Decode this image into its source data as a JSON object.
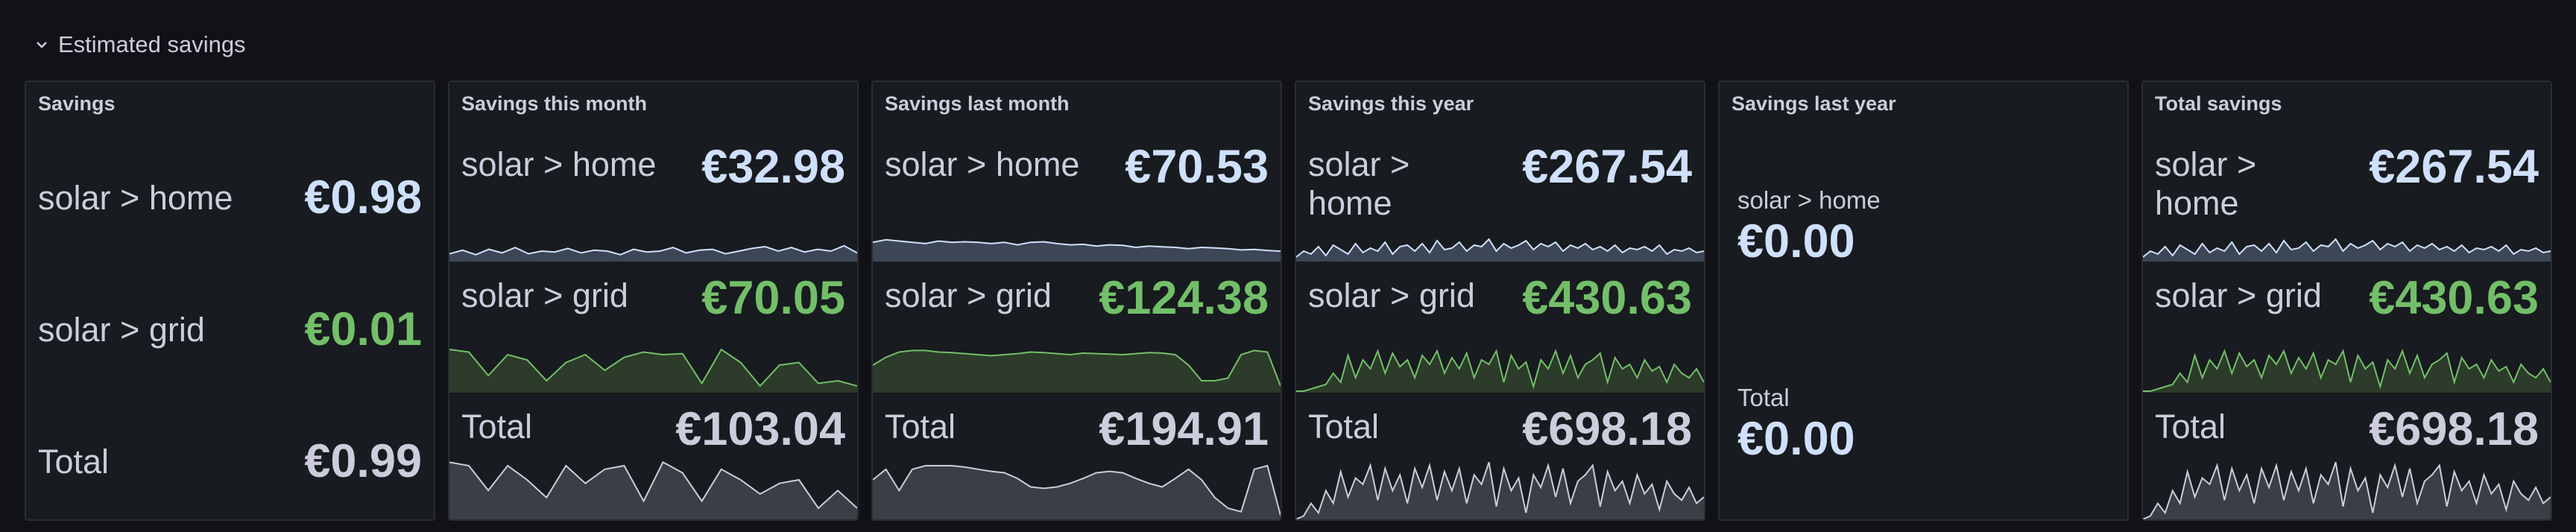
{
  "row": {
    "title": "Estimated savings"
  },
  "colors": {
    "blue": "#cfe0fc",
    "green": "#73bf69",
    "text": "#ccccdc",
    "blue_fill": "#3d4656",
    "green_fill": "#2d3b2a",
    "total_fill": "#3c3e45"
  },
  "savings": {
    "title": "Savings",
    "rows": [
      {
        "label": "solar > home",
        "value": "€0.98"
      },
      {
        "label": "solar > grid",
        "value": "€0.01"
      },
      {
        "label": "Total",
        "value": "€0.99"
      }
    ]
  },
  "this_month": {
    "title": "Savings this month",
    "rows": [
      {
        "label": "solar > home",
        "value": "€32.98",
        "series": [
          0.35,
          0.55,
          0.3,
          0.6,
          0.4,
          0.7,
          0.35,
          0.5,
          0.45,
          0.65,
          0.4,
          0.55,
          0.5,
          0.3,
          0.6,
          0.45,
          0.5,
          0.7,
          0.4,
          0.55,
          0.6,
          0.35,
          0.5,
          0.65,
          0.75,
          0.5,
          0.7,
          0.45,
          0.6,
          0.5,
          0.8,
          0.4
        ]
      },
      {
        "label": "solar > grid",
        "value": "€70.05",
        "series": [
          0.8,
          0.75,
          0.3,
          0.7,
          0.6,
          0.2,
          0.55,
          0.7,
          0.4,
          0.65,
          0.75,
          0.7,
          0.72,
          0.15,
          0.8,
          0.55,
          0.1,
          0.5,
          0.55,
          0.15,
          0.2,
          0.1
        ]
      },
      {
        "label": "Total",
        "value": "€103.04",
        "series": [
          0.85,
          0.8,
          0.45,
          0.8,
          0.6,
          0.35,
          0.8,
          0.55,
          0.75,
          0.8,
          0.3,
          0.85,
          0.7,
          0.3,
          0.75,
          0.6,
          0.4,
          0.55,
          0.6,
          0.2,
          0.45,
          0.2
        ]
      }
    ]
  },
  "last_month": {
    "title": "Savings last month",
    "rows": [
      {
        "label": "solar > home",
        "value": "€70.53",
        "series": [
          0.7,
          0.8,
          0.75,
          0.7,
          0.65,
          0.75,
          0.7,
          0.72,
          0.7,
          0.65,
          0.7,
          0.6,
          0.7,
          0.72,
          0.65,
          0.6,
          0.62,
          0.55,
          0.6,
          0.58,
          0.5,
          0.55,
          0.52,
          0.5,
          0.45,
          0.5,
          0.48,
          0.45,
          0.4,
          0.42,
          0.38,
          0.35
        ]
      },
      {
        "label": "solar > grid",
        "value": "€124.38",
        "series": [
          0.5,
          0.65,
          0.75,
          0.78,
          0.78,
          0.75,
          0.74,
          0.72,
          0.7,
          0.68,
          0.7,
          0.72,
          0.75,
          0.74,
          0.72,
          0.7,
          0.73,
          0.72,
          0.71,
          0.7,
          0.72,
          0.74,
          0.73,
          0.7,
          0.5,
          0.2,
          0.2,
          0.25,
          0.7,
          0.78,
          0.75,
          0.1
        ]
      },
      {
        "label": "Total",
        "value": "€194.91",
        "series": [
          0.6,
          0.75,
          0.45,
          0.75,
          0.8,
          0.8,
          0.8,
          0.78,
          0.75,
          0.72,
          0.7,
          0.62,
          0.5,
          0.48,
          0.5,
          0.55,
          0.62,
          0.7,
          0.72,
          0.7,
          0.62,
          0.55,
          0.5,
          0.62,
          0.75,
          0.6,
          0.35,
          0.2,
          0.15,
          0.75,
          0.8,
          0.1
        ]
      }
    ]
  },
  "this_year": {
    "title": "Savings this year",
    "rows": [
      {
        "label": "solar > home",
        "value": "€267.54",
        "series": [
          0.1,
          0.3,
          0.2,
          0.45,
          0.15,
          0.5,
          0.35,
          0.2,
          0.55,
          0.25,
          0.4,
          0.3,
          0.6,
          0.2,
          0.45,
          0.5,
          0.3,
          0.55,
          0.25,
          0.65,
          0.35,
          0.4,
          0.6,
          0.3,
          0.5,
          0.45,
          0.7,
          0.3,
          0.55,
          0.4,
          0.5,
          0.65,
          0.35,
          0.55,
          0.45,
          0.6,
          0.3,
          0.5,
          0.4,
          0.55,
          0.35,
          0.45,
          0.3,
          0.5,
          0.25,
          0.4,
          0.35,
          0.45,
          0.3,
          0.5,
          0.2,
          0.35,
          0.3,
          0.4,
          0.25,
          0.3
        ]
      },
      {
        "label": "solar > grid",
        "value": "€430.63",
        "series": [
          0.0,
          0.0,
          0.05,
          0.1,
          0.15,
          0.4,
          0.2,
          0.8,
          0.3,
          0.7,
          0.5,
          0.9,
          0.4,
          0.85,
          0.55,
          0.7,
          0.3,
          0.8,
          0.6,
          0.9,
          0.4,
          0.75,
          0.5,
          0.85,
          0.3,
          0.7,
          0.6,
          0.9,
          0.2,
          0.8,
          0.5,
          0.65,
          0.1,
          0.7,
          0.5,
          0.9,
          0.4,
          0.8,
          0.3,
          0.6,
          0.7,
          0.85,
          0.2,
          0.75,
          0.5,
          0.6,
          0.3,
          0.7,
          0.45,
          0.55,
          0.2,
          0.6,
          0.4,
          0.3,
          0.5,
          0.2
        ]
      },
      {
        "label": "Total",
        "value": "€698.18",
        "series": [
          0.05,
          0.1,
          0.3,
          0.15,
          0.5,
          0.3,
          0.8,
          0.4,
          0.7,
          0.6,
          0.9,
          0.35,
          0.85,
          0.5,
          0.75,
          0.3,
          0.85,
          0.55,
          0.9,
          0.35,
          0.8,
          0.5,
          0.85,
          0.3,
          0.75,
          0.6,
          0.95,
          0.25,
          0.85,
          0.5,
          0.7,
          0.15,
          0.75,
          0.55,
          0.9,
          0.4,
          0.85,
          0.3,
          0.65,
          0.75,
          0.9,
          0.25,
          0.8,
          0.5,
          0.65,
          0.3,
          0.75,
          0.45,
          0.6,
          0.2,
          0.65,
          0.45,
          0.35,
          0.55,
          0.3,
          0.4
        ]
      }
    ]
  },
  "last_year": {
    "title": "Savings last year",
    "rows": [
      {
        "label": "solar > home",
        "value": "€0.00"
      },
      {
        "label": "Total",
        "value": "€0.00"
      }
    ]
  },
  "total": {
    "title": "Total savings",
    "rows": [
      {
        "label": "solar > home",
        "value": "€267.54",
        "series": [
          0.1,
          0.3,
          0.2,
          0.45,
          0.15,
          0.5,
          0.35,
          0.2,
          0.55,
          0.25,
          0.4,
          0.3,
          0.6,
          0.2,
          0.45,
          0.5,
          0.3,
          0.55,
          0.25,
          0.65,
          0.35,
          0.4,
          0.6,
          0.3,
          0.5,
          0.45,
          0.7,
          0.3,
          0.55,
          0.4,
          0.5,
          0.65,
          0.35,
          0.55,
          0.45,
          0.6,
          0.3,
          0.5,
          0.4,
          0.55,
          0.35,
          0.45,
          0.3,
          0.5,
          0.25,
          0.4,
          0.35,
          0.45,
          0.3,
          0.5,
          0.2,
          0.35,
          0.3,
          0.4,
          0.25,
          0.3
        ]
      },
      {
        "label": "solar > grid",
        "value": "€430.63",
        "series": [
          0.0,
          0.0,
          0.05,
          0.1,
          0.15,
          0.4,
          0.2,
          0.8,
          0.3,
          0.7,
          0.5,
          0.9,
          0.4,
          0.85,
          0.55,
          0.7,
          0.3,
          0.8,
          0.6,
          0.9,
          0.4,
          0.75,
          0.5,
          0.85,
          0.3,
          0.7,
          0.6,
          0.9,
          0.2,
          0.8,
          0.5,
          0.65,
          0.1,
          0.7,
          0.5,
          0.9,
          0.4,
          0.8,
          0.3,
          0.6,
          0.7,
          0.85,
          0.2,
          0.75,
          0.5,
          0.6,
          0.3,
          0.7,
          0.45,
          0.55,
          0.2,
          0.6,
          0.4,
          0.3,
          0.5,
          0.2
        ]
      },
      {
        "label": "Total",
        "value": "€698.18",
        "series": [
          0.05,
          0.1,
          0.3,
          0.15,
          0.5,
          0.3,
          0.8,
          0.4,
          0.7,
          0.6,
          0.9,
          0.35,
          0.85,
          0.5,
          0.75,
          0.3,
          0.85,
          0.55,
          0.9,
          0.35,
          0.8,
          0.5,
          0.85,
          0.3,
          0.75,
          0.6,
          0.95,
          0.25,
          0.85,
          0.5,
          0.7,
          0.15,
          0.75,
          0.55,
          0.9,
          0.4,
          0.85,
          0.3,
          0.65,
          0.75,
          0.9,
          0.25,
          0.8,
          0.5,
          0.65,
          0.3,
          0.75,
          0.45,
          0.6,
          0.2,
          0.65,
          0.45,
          0.35,
          0.55,
          0.3,
          0.4
        ]
      }
    ]
  }
}
